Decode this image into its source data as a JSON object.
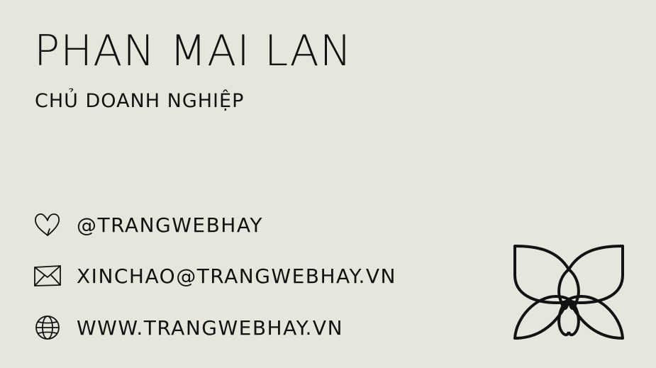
{
  "card": {
    "name": "PHAN MAI LAN",
    "title": "CHỦ DOANH NGHIỆP",
    "background_color": "#e7e6dc",
    "text_color": "#121212"
  },
  "contacts": [
    {
      "icon": "heart-icon",
      "text": "@TRANGWEBHAY"
    },
    {
      "icon": "envelope-icon",
      "text": "XINCHAO@TRANGWEBHAY.VN"
    },
    {
      "icon": "globe-icon",
      "text": "WWW.TRANGWEBHAY.VN"
    }
  ],
  "logo": {
    "icon": "butterfly-logo-icon"
  }
}
